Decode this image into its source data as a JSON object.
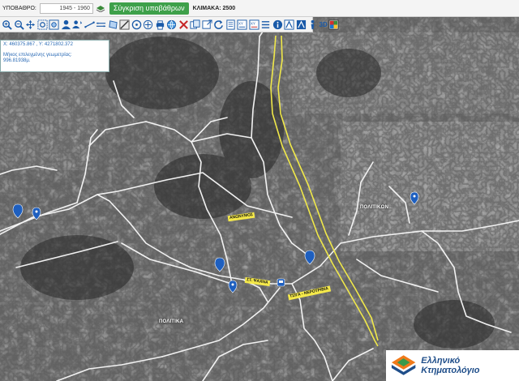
{
  "topbar": {
    "background_label": "ΥΠΟΒΑΘΡΟ:",
    "period": "1945 - 1960",
    "compare_button": "Σύγκριση υποβάθρων",
    "scale_label": "ΚΛΙΜΑΚΑ: 2500"
  },
  "toolbar": {
    "three_d_label": "3D",
    "tool_icons": [
      "zoom-in-icon",
      "zoom-out-icon",
      "pan-icon",
      "zoom-box-icon",
      "zoom-extent-icon",
      "user-icon",
      "user-location-icon",
      "measure-line-icon",
      "measure-area-icon",
      "polygon-icon",
      "identify-icon",
      "circle-tool-icon",
      "marker-icon",
      "print-icon",
      "globe-icon",
      "clear-icon",
      "copy-icon",
      "export-icon",
      "refresh-icon",
      "document-icon",
      "coordinates-xy-icon",
      "coordinates-xy-alt-icon",
      "list-icon",
      "info-icon",
      "legend-icon",
      "layers-active-icon",
      "three-d-icon",
      "color-picker-icon"
    ]
  },
  "infobox": {
    "coords": "X: 460375.867 , Y: 4271802.372",
    "length_label": "Μήκος επιλεγμένης γεωμετρίας:",
    "length_value": "996.81938μ."
  },
  "map_labels": {
    "politikon": "ΠΟΛΙΤΙΚΩΝ",
    "politika": "ΠΟΛΙΤΙΚΑ",
    "road_anonymos": "ΑΝΩΝΥΜΟΣ",
    "road_stop": "ΣΤ. ΨΑΧΝΑ",
    "road_tsiga": "ΤΣΙΓΑ - ΝΕΡΟΤΡΙΒΙΑ"
  },
  "logo": {
    "text": "Ελληνικό Κτηματολόγιο"
  },
  "colors": {
    "accent_green": "#3ea04a",
    "selection_yellow": "#f0e84a",
    "pin_blue": "#1e5fbf",
    "road_white": "#f2f2f2",
    "brand_blue": "#1f4e8a"
  }
}
